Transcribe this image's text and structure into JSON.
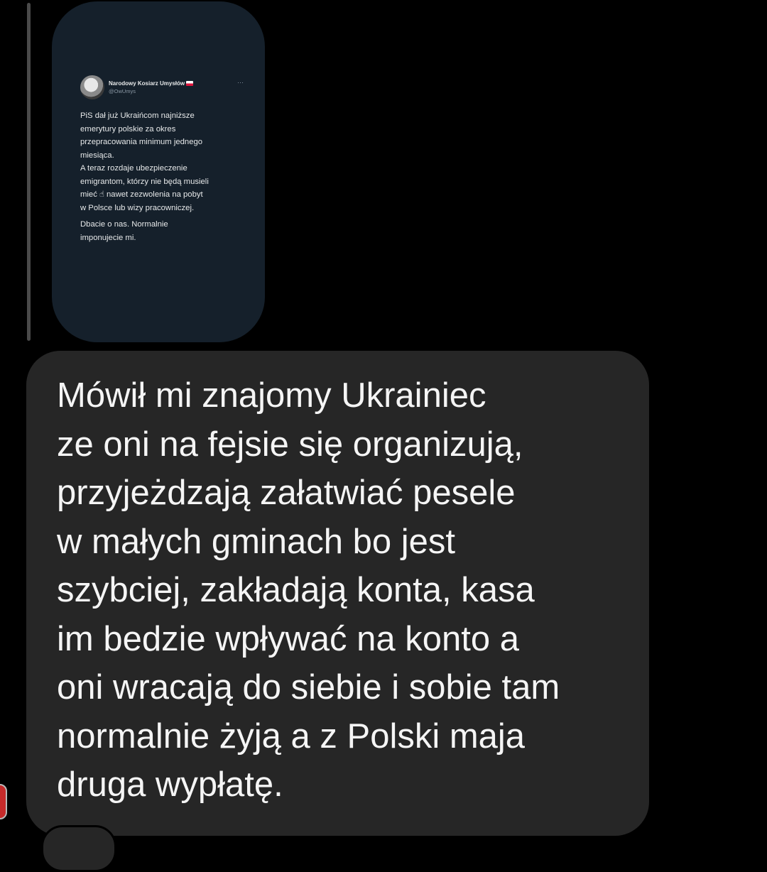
{
  "thread": {
    "shared_media": {
      "tweet": {
        "author_name": "Narodowy Kosiarz Umysłów",
        "handle": "@OwUmys",
        "paragraphs": [
          "PiS dał już Ukraińcom najniższe\nemerytury polskie za okres\nprzepracowania minimum jednego\nmiesiąca.\nA teraz rozdaje ubezpieczenie\nemigrantom, którzy nie będą musieli\nmieć ☝ nawet zezwolenia na pobyt\nw Polsce lub wizy pracowniczej.",
          "Dbacie o nas. Normalnie\nimponujecie mi."
        ]
      }
    },
    "message": {
      "text": "Mówił mi znajomy Ukrainiec\nze oni na fejsie się organizują,\nprzyjeżdzają załatwiać pesele\nw małych gminach bo jest\nszybciej, zakładają konta, kasa\nim bedzie wpływać na konto a\noni wracają do siebie i sobie tam\nnormalnie żyją a z Polski maja\ndruga wypłatę."
    }
  },
  "colors": {
    "background": "#000000",
    "tweet_card_background": "#15202b",
    "message_bubble_background": "#262626",
    "message_text": "#f5f5f5"
  }
}
